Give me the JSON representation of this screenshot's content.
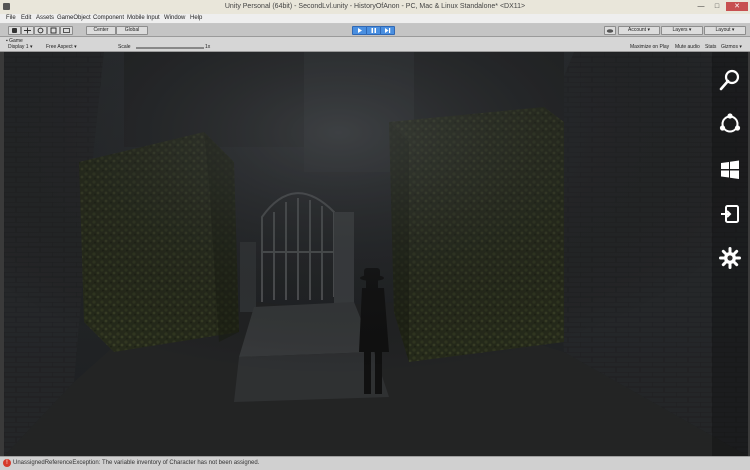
{
  "window": {
    "title": "Unity Personal (64bit) - SecondLvl.unity - HistoryOfAnon - PC, Mac & Linux Standalone* <DX11>",
    "minimize_glyph": "—",
    "maximize_glyph": "□",
    "close_glyph": "✕"
  },
  "menubar": {
    "items": [
      "File",
      "Edit",
      "Assets",
      "GameObject",
      "Component",
      "Mobile Input",
      "Window",
      "Help"
    ]
  },
  "toolbar": {
    "pivot_label": "Center",
    "space_label": "Global",
    "account_label": "Account",
    "layers_label": "Layers",
    "layout_label": "Layout"
  },
  "game_view": {
    "tab_label": "Game",
    "display_label": "Display 1",
    "aspect_label": "Free Aspect",
    "scale_label": "Scale",
    "scale_value": "1x",
    "maximize_on_play": "Maximize on Play",
    "mute_audio": "Mute audio",
    "stats": "Stats",
    "gizmos": "Gizmos"
  },
  "charms": [
    "search-icon",
    "share-icon",
    "windows-start-icon",
    "devices-icon",
    "settings-icon"
  ],
  "status": {
    "error_glyph": "!",
    "message": "UnassignedReferenceException: The variable inventory of Character has not been assigned."
  },
  "colors": {
    "close_button": "#c75050",
    "play_button": "#4a8fe0",
    "error_icon": "#d63a2a"
  }
}
